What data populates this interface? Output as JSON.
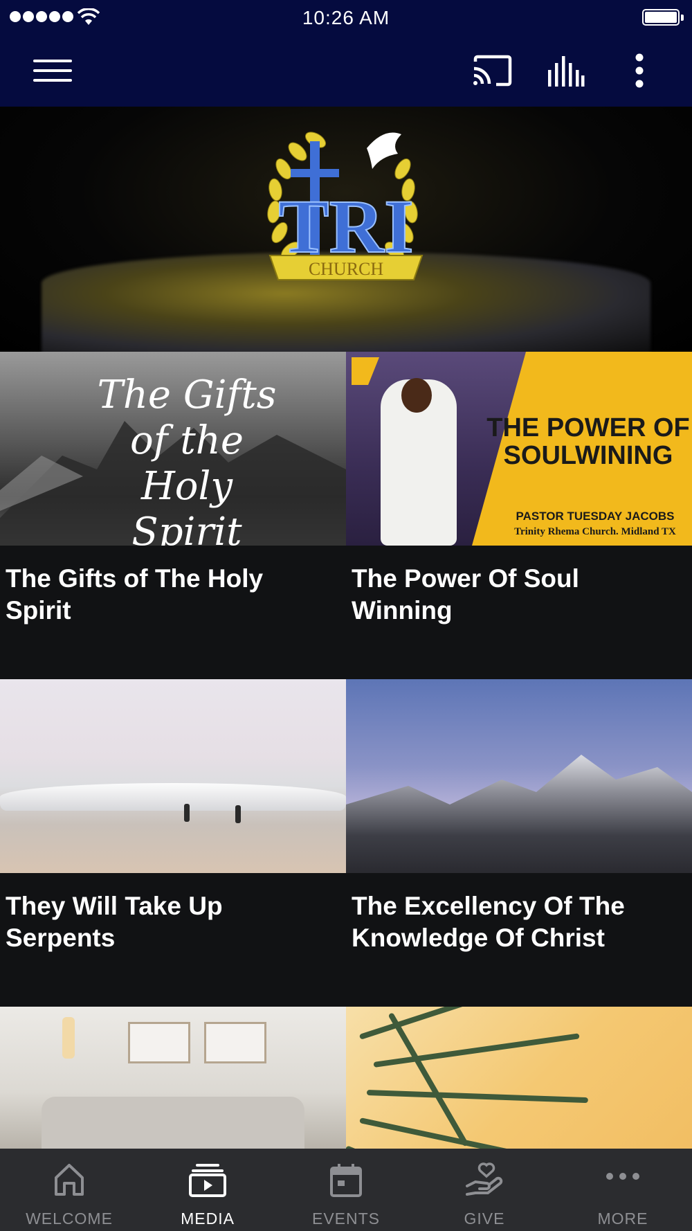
{
  "status_bar": {
    "time": "10:26 AM"
  },
  "toolbar": {
    "icons": [
      "menu-icon",
      "cast-icon",
      "audio-bars-icon",
      "more-vertical-icon"
    ]
  },
  "hero": {
    "logo_text": "CHURCH",
    "logo_initials": "TRI"
  },
  "cards": [
    {
      "title": "The Gifts of The Holy Spirit",
      "thumb_text": "The Gifts of the Holy Spirit"
    },
    {
      "title": "The Power Of Soul Winning",
      "thumb_title": "THE POWER OF SOULWINING",
      "thumb_sub1": "PASTOR TUESDAY JACOBS",
      "thumb_sub2": "Trinity Rhema Church. Midland TX"
    },
    {
      "title": "They Will Take Up Serpents"
    },
    {
      "title": "The Excellency Of The Knowledge Of Christ"
    },
    {
      "title": ""
    },
    {
      "title": ""
    }
  ],
  "bottom_nav": [
    {
      "label": "WELCOME",
      "icon": "home-icon",
      "active": false
    },
    {
      "label": "MEDIA",
      "icon": "media-play-icon",
      "active": true
    },
    {
      "label": "EVENTS",
      "icon": "calendar-icon",
      "active": false
    },
    {
      "label": "GIVE",
      "icon": "give-hand-heart-icon",
      "active": false
    },
    {
      "label": "MORE",
      "icon": "more-horizontal-icon",
      "active": false
    }
  ],
  "colors": {
    "header": "#050b3f",
    "background": "#111214",
    "nav": "#2b2c2f",
    "accent_yellow": "#f2b91c"
  }
}
